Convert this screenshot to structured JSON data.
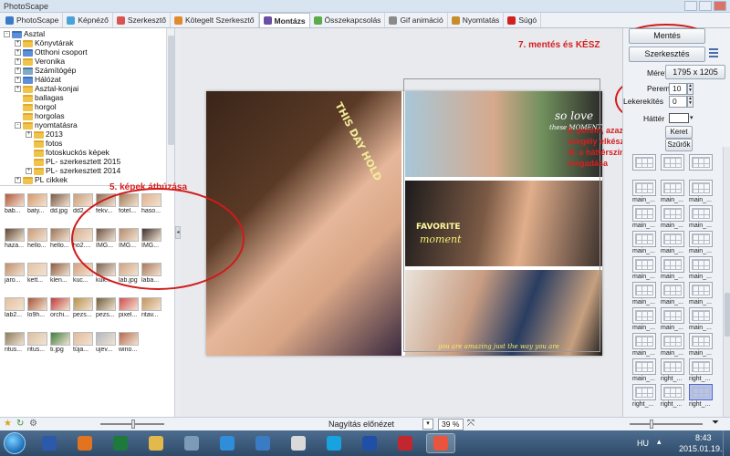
{
  "window": {
    "title": "PhotoScape"
  },
  "tabs": [
    {
      "label": "PhotoScape",
      "color": "#3b7ac9"
    },
    {
      "label": "Képnéző",
      "color": "#4aa2d8"
    },
    {
      "label": "Szerkesztő",
      "color": "#d9534f"
    },
    {
      "label": "Kötegelt Szerkesztő",
      "color": "#e08a2e"
    },
    {
      "label": "Montázs",
      "color": "#6b4fa3"
    },
    {
      "label": "Összekapcsolás",
      "color": "#5bab4a"
    },
    {
      "label": "Gif animáció",
      "color": "#8a8a8a"
    },
    {
      "label": "Nyomtatás",
      "color": "#c78d2a"
    },
    {
      "label": "Súgó",
      "color": "#d12020"
    }
  ],
  "tree": {
    "nodes": [
      {
        "label": "Asztal",
        "level": 0,
        "icon": "folder-blue",
        "expander": "-"
      },
      {
        "label": "Könyvtárak",
        "level": 1,
        "icon": "folder",
        "expander": "+"
      },
      {
        "label": "Otthoni csoport",
        "level": 1,
        "icon": "folder-blue",
        "expander": "+"
      },
      {
        "label": "Veronika",
        "level": 1,
        "icon": "folder",
        "expander": "+"
      },
      {
        "label": "Számítógép",
        "level": 1,
        "icon": "computer",
        "expander": "+"
      },
      {
        "label": "Hálózat",
        "level": 1,
        "icon": "folder-blue",
        "expander": "+"
      },
      {
        "label": "Asztal-konjai",
        "level": 1,
        "icon": "folder",
        "expander": "+"
      },
      {
        "label": "ballagas",
        "level": 1,
        "icon": "folder",
        "expander": ""
      },
      {
        "label": "horgol",
        "level": 1,
        "icon": "folder",
        "expander": ""
      },
      {
        "label": "horgolas",
        "level": 1,
        "icon": "folder",
        "expander": ""
      },
      {
        "label": "nyomtatásra",
        "level": 1,
        "icon": "folder",
        "expander": "-"
      },
      {
        "label": "2013",
        "level": 2,
        "icon": "folder",
        "expander": "+"
      },
      {
        "label": "fotos",
        "level": 2,
        "icon": "folder",
        "expander": ""
      },
      {
        "label": "fotoskuckós képek",
        "level": 2,
        "icon": "folder",
        "expander": ""
      },
      {
        "label": "PL- szerkesztett 2015",
        "level": 2,
        "icon": "folder",
        "expander": ""
      },
      {
        "label": "PL- szerkesztett 2014",
        "level": 2,
        "icon": "folder",
        "expander": "+"
      },
      {
        "label": "PL cikkek",
        "level": 1,
        "icon": "folder",
        "expander": "+"
      }
    ]
  },
  "thumbnails": [
    {
      "label": "bab...",
      "color": "#b3583c"
    },
    {
      "label": "baty...",
      "color": "#d49a6a"
    },
    {
      "label": "dd.jpg",
      "color": "#7a5a44"
    },
    {
      "label": "dd2....",
      "color": "#c9a07a"
    },
    {
      "label": "fekv...",
      "color": "#8f6a50"
    },
    {
      "label": "fotel...",
      "color": "#a37b5a"
    },
    {
      "label": "haso...",
      "color": "#e0b18c"
    },
    {
      "label": "haza...",
      "color": "#5e4636"
    },
    {
      "label": "hello...",
      "color": "#c99b78"
    },
    {
      "label": "hello...",
      "color": "#9f7658"
    },
    {
      "label": "ho2....",
      "color": "#d8b090"
    },
    {
      "label": "IMG...",
      "color": "#6d5444"
    },
    {
      "label": "IMG...",
      "color": "#b48c6c"
    },
    {
      "label": "IMG...",
      "color": "#3d2f2b"
    },
    {
      "label": "jaro...",
      "color": "#c08e6b"
    },
    {
      "label": "kett...",
      "color": "#e4c3a6"
    },
    {
      "label": "klen...",
      "color": "#8c5a3e"
    },
    {
      "label": "kuc...",
      "color": "#d7a07d"
    },
    {
      "label": "kuk...",
      "color": "#7c6350"
    },
    {
      "label": "lab.jpg",
      "color": "#cfa382"
    },
    {
      "label": "laba...",
      "color": "#a9785a"
    },
    {
      "label": "lab2...",
      "color": "#e5c09f"
    },
    {
      "label": "lo9h...",
      "color": "#a65436"
    },
    {
      "label": "orchi...",
      "color": "#c23b3b"
    },
    {
      "label": "pezs...",
      "color": "#b5924e"
    },
    {
      "label": "pezs...",
      "color": "#6f5f3c"
    },
    {
      "label": "pixel...",
      "color": "#d14e4e"
    },
    {
      "label": "ritav...",
      "color": "#c4945c"
    },
    {
      "label": "ritus...",
      "color": "#8e7c5c"
    },
    {
      "label": "ritus...",
      "color": "#d8c1a2"
    },
    {
      "label": "ti.jpg",
      "color": "#3f7f3f"
    },
    {
      "label": "tüja...",
      "color": "#e2b99a"
    },
    {
      "label": "ujev...",
      "color": "#b2b7c2"
    },
    {
      "label": "wino...",
      "color": "#b66a4c"
    }
  ],
  "collage": {
    "overlays": {
      "hold": "THIS DAY HOLD",
      "love": "so love",
      "moments": "these MOMENTS",
      "favorite": "FAVORITE",
      "moment": "moment",
      "amazing": "you are amazing just the way you are"
    }
  },
  "annotations": {
    "save": "7. mentés és KÉSZ",
    "drag": "5. képek áthúzása",
    "border_line1": "6. perem, azaz fehér",
    "border_line2": "szegély elkészítése,",
    "border_line3": "ill. a háttérszín",
    "border_line4": "megadása"
  },
  "right_panel": {
    "save_button": "Mentés",
    "edit_button": "Szerkesztés",
    "size_label": "Méret",
    "size_value": "1795 x 1205",
    "margin_label": "Perem",
    "margin_value": "10",
    "rounding_label": "Lekerekítés",
    "rounding_value": "0",
    "background_label": "Háttér",
    "background_color": "#ffffff",
    "frame_button": "Keret",
    "filter_button": "Szűrők",
    "templates": [
      {
        "label": ""
      },
      {
        "label": ""
      },
      {
        "label": ""
      },
      {
        "label": "main_..."
      },
      {
        "label": "main_..."
      },
      {
        "label": "main_..."
      },
      {
        "label": "main_..."
      },
      {
        "label": "main_..."
      },
      {
        "label": "main_..."
      },
      {
        "label": "main_..."
      },
      {
        "label": "main_..."
      },
      {
        "label": "main_..."
      },
      {
        "label": "main_..."
      },
      {
        "label": "main_..."
      },
      {
        "label": "main_..."
      },
      {
        "label": "main_..."
      },
      {
        "label": "main_..."
      },
      {
        "label": "main_..."
      },
      {
        "label": "main_..."
      },
      {
        "label": "main_..."
      },
      {
        "label": "main_..."
      },
      {
        "label": "main_..."
      },
      {
        "label": "main_..."
      },
      {
        "label": "main_..."
      },
      {
        "label": "main_..."
      },
      {
        "label": "right_..."
      },
      {
        "label": "right_..."
      },
      {
        "label": "right_..."
      },
      {
        "label": "right_..."
      },
      {
        "label": "right_..."
      }
    ],
    "selected_template": 29
  },
  "statusbar": {
    "zoom_preview_label": "Nagyítás előnézet",
    "zoom_value": "39 %"
  },
  "taskbar": {
    "language": "HU",
    "time": "8:43",
    "date": "2015.01.19.",
    "apps": [
      {
        "name": "word-icon",
        "color": "#2b5aab"
      },
      {
        "name": "firefox-icon",
        "color": "#e2731f"
      },
      {
        "name": "excel-icon",
        "color": "#1d7a3c"
      },
      {
        "name": "explorer-icon",
        "color": "#e3b94b"
      },
      {
        "name": "photo-icon",
        "color": "#7d9ab8"
      },
      {
        "name": "ie-icon",
        "color": "#2f8ed9"
      },
      {
        "name": "media-player-icon",
        "color": "#3a7cc4"
      },
      {
        "name": "chrome-icon",
        "color": "#d9d9d9"
      },
      {
        "name": "skype-icon",
        "color": "#16a3e0"
      },
      {
        "name": "malware-icon",
        "color": "#1f4fa6"
      },
      {
        "name": "pdf-icon",
        "color": "#c1272d"
      },
      {
        "name": "photoscape-icon",
        "color": "#e8543d"
      }
    ]
  }
}
